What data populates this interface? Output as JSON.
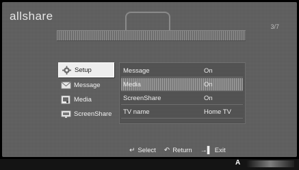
{
  "app": {
    "brand": "allshare",
    "page_number": "3/7"
  },
  "left_menu": {
    "items": [
      {
        "label": "Setup",
        "icon": "gear-icon",
        "selected": true
      },
      {
        "label": "Message",
        "icon": "envelope-icon",
        "selected": false
      },
      {
        "label": "Media",
        "icon": "media-icon",
        "selected": false
      },
      {
        "label": "ScreenShare",
        "icon": "screenshare-icon",
        "selected": false
      }
    ]
  },
  "settings": {
    "rows": [
      {
        "label": "Message",
        "value": "On"
      },
      {
        "label": "Media",
        "value": "On"
      },
      {
        "label": "ScreenShare",
        "value": "On"
      },
      {
        "label": "TV name",
        "value": "Home TV"
      }
    ]
  },
  "footer": {
    "select_label": "Select",
    "return_label": "Return",
    "exit_label": "Exit"
  },
  "bottom": {
    "letter": "A"
  },
  "colors": {
    "background": "#5f5f5f",
    "panel": "#4e4e4e",
    "selected_item": "#eeeeee",
    "text": "#f0f0f0"
  }
}
